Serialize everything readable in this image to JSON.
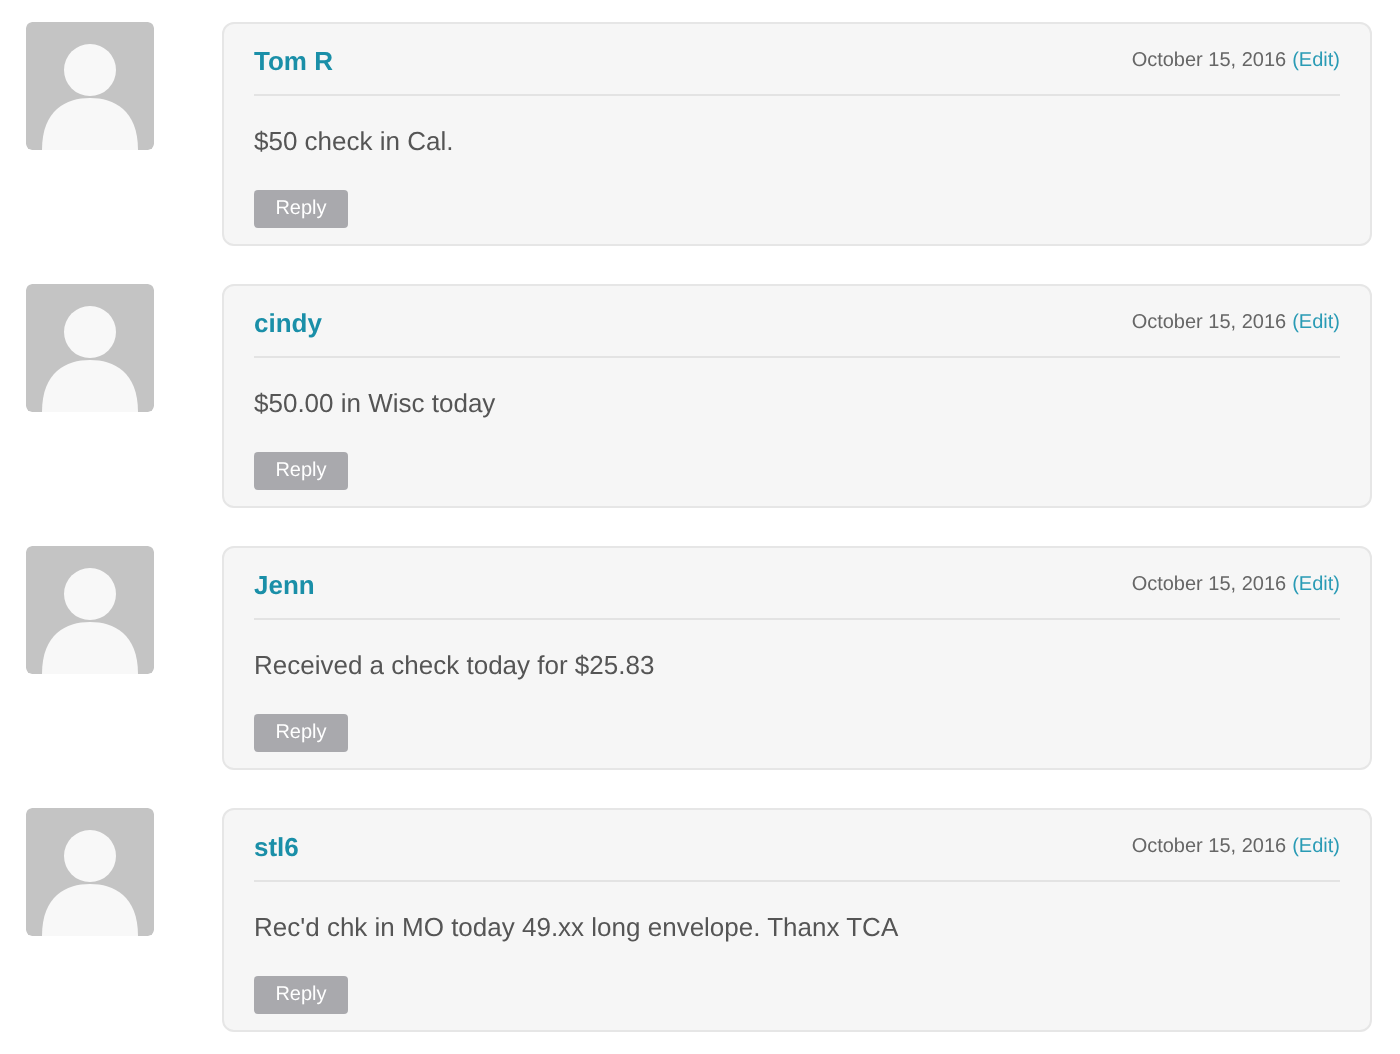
{
  "comments": [
    {
      "author": "Tom R",
      "date": "October 15, 2016",
      "edit": "(Edit)",
      "text": "$50 check in Cal.",
      "reply": "Reply"
    },
    {
      "author": "cindy",
      "date": "October 15, 2016",
      "edit": "(Edit)",
      "text": "$50.00 in Wisc today",
      "reply": "Reply"
    },
    {
      "author": "Jenn",
      "date": "October 15, 2016",
      "edit": "(Edit)",
      "text": "Received a check today for $25.83",
      "reply": "Reply"
    },
    {
      "author": "stl6",
      "date": "October 15, 2016",
      "edit": "(Edit)",
      "text": "Rec'd chk in MO today 49.xx long envelope. Thanx TCA",
      "reply": "Reply"
    }
  ]
}
